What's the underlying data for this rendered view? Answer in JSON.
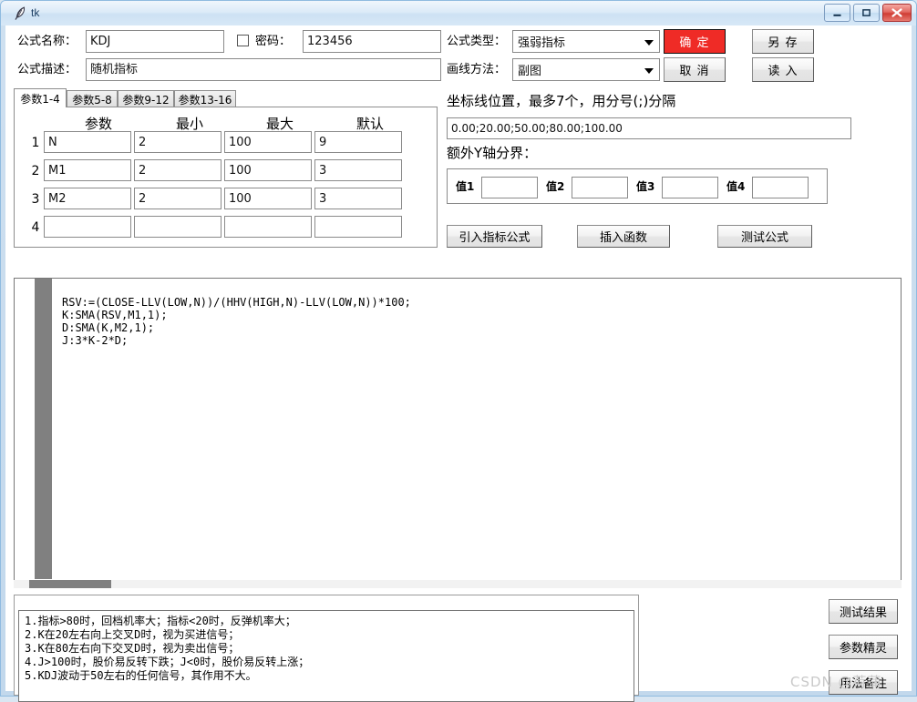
{
  "window": {
    "title": "tk",
    "icon": "feather-icon",
    "controls": {
      "minimize": "minimize-icon",
      "maximize": "maximize-icon",
      "close": "close-icon"
    }
  },
  "header": {
    "formula_name_label": "公式名称：",
    "formula_name_value": "KDJ",
    "password_label": "密码：",
    "password_checked": false,
    "password_value": "123456",
    "formula_type_label": "公式类型：",
    "formula_type_value": "强弱指标",
    "formula_desc_label": "公式描述：",
    "formula_desc_value": "随机指标",
    "draw_method_label": "画线方法：",
    "draw_method_value": "副图",
    "confirm_button": "确 定",
    "cancel_button": "取 消",
    "save_as_button": "另 存",
    "load_button": "读 入",
    "confirm_color": "#ef2b26"
  },
  "param_panel": {
    "tabs": [
      {
        "label": "参数1-4",
        "active": true
      },
      {
        "label": "参数5-8",
        "active": false
      },
      {
        "label": "参数9-12",
        "active": false
      },
      {
        "label": "参数13-16",
        "active": false
      }
    ],
    "columns": [
      "参数",
      "最小",
      "最大",
      "默认"
    ],
    "rows": [
      {
        "num": "1",
        "name": "N",
        "min": "2",
        "max": "100",
        "default": "9"
      },
      {
        "num": "2",
        "name": "M1",
        "min": "2",
        "max": "100",
        "default": "3"
      },
      {
        "num": "3",
        "name": "M2",
        "min": "2",
        "max": "100",
        "default": "3"
      },
      {
        "num": "4",
        "name": "",
        "min": "",
        "max": "",
        "default": ""
      }
    ]
  },
  "coord_panel": {
    "coord_line_label": "坐标线位置，最多7个，用分号(;)分隔",
    "coord_line_value": "0.00;20.00;50.00;80.00;100.00",
    "extra_y_label": "额外Y轴分界：",
    "values": [
      {
        "label": "值1",
        "value": ""
      },
      {
        "label": "值2",
        "value": ""
      },
      {
        "label": "值3",
        "value": ""
      },
      {
        "label": "值4",
        "value": ""
      }
    ],
    "import_formula_button": "引入指标公式",
    "insert_function_button": "插入函数",
    "test_formula_button": "测试公式"
  },
  "editor": {
    "code": "RSV:=(CLOSE-LLV(LOW,N))/(HHV(HIGH,N)-LLV(LOW,N))*100;\nK:SMA(RSV,M1,1);\nD:SMA(K,M2,1);\nJ:3*K-2*D;"
  },
  "description": {
    "text": "1.指标>80时，回档机率大；指标<20时，反弹机率大；\n2.K在20左右向上交叉D时，视为买进信号；\n3.K在80左右向下交叉D时，视为卖出信号；\n4.J>100时，股价易反转下跌；J<0时，股价易反转上涨；\n5.KDJ波动于50左右的任何信号，其作用不大。"
  },
  "side_buttons": {
    "test_result": "测试结果",
    "param_wizard": "参数精灵",
    "usage_notes": "用法备注"
  },
  "watermark": "CSDN @荷蒲"
}
